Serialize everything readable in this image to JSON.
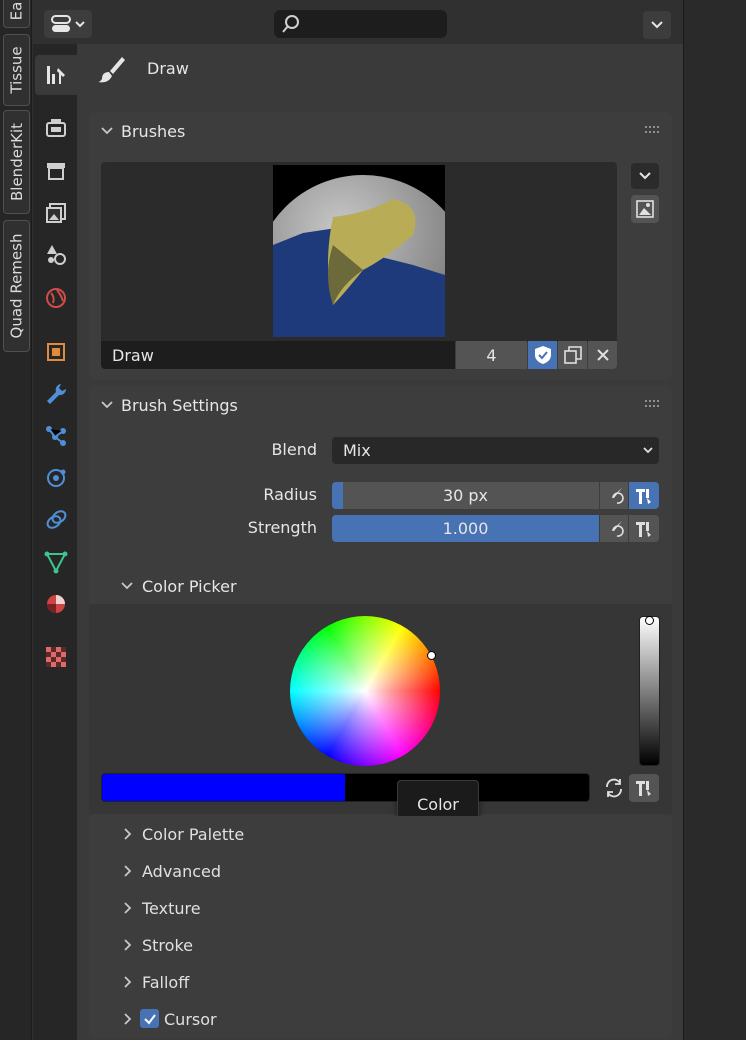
{
  "addon_tabs": [
    {
      "label": "Ea"
    },
    {
      "label": "Tissue"
    },
    {
      "label": "BlenderKit"
    },
    {
      "label": "Quad Remesh"
    }
  ],
  "header": {
    "search_placeholder": ""
  },
  "tool": {
    "name": "Draw"
  },
  "brushes": {
    "title": "Brushes",
    "brush_name": "Draw",
    "users": "4"
  },
  "brush_settings": {
    "title": "Brush Settings",
    "blend_label": "Blend",
    "blend_value": "Mix",
    "radius_label": "Radius",
    "radius_value": "30 px",
    "radius_fraction": 0.04,
    "strength_label": "Strength",
    "strength_value": "1.000",
    "strength_fraction": 1.0
  },
  "color_picker": {
    "title": "Color Picker",
    "color_hex": "#0000ff",
    "tooltip": "Color"
  },
  "subpanels": [
    {
      "label": "Color Palette"
    },
    {
      "label": "Advanced"
    },
    {
      "label": "Texture"
    },
    {
      "label": "Stroke"
    },
    {
      "label": "Falloff"
    },
    {
      "label": "Cursor"
    }
  ],
  "colors": {
    "accent": "#4772b3",
    "panel_bg": "#3d3d3d"
  }
}
